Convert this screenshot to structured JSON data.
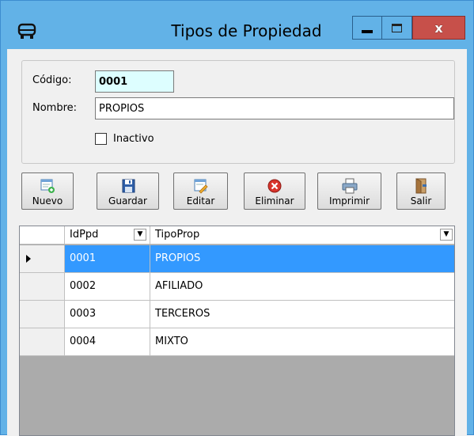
{
  "window": {
    "title": "Tipos de Propiedad",
    "close_label": "x"
  },
  "form": {
    "codigo_label": "Código:",
    "codigo_value": "0001",
    "nombre_label": "Nombre:",
    "nombre_value": "PROPIOS",
    "inactivo_label": "Inactivo",
    "inactivo_checked": false
  },
  "toolbar": {
    "nuevo": "Nuevo",
    "guardar": "Guardar",
    "editar": "Editar",
    "eliminar": "Eliminar",
    "imprimir": "Imprimir",
    "salir": "Salir"
  },
  "grid": {
    "columns": [
      "IdPpd",
      "TipoProp"
    ],
    "rows": [
      {
        "id": "0001",
        "tipo": "PROPIOS",
        "selected": true
      },
      {
        "id": "0002",
        "tipo": "AFILIADO",
        "selected": false
      },
      {
        "id": "0003",
        "tipo": "TERCEROS",
        "selected": false
      },
      {
        "id": "0004",
        "tipo": "MIXTO",
        "selected": false
      }
    ]
  },
  "colors": {
    "title_bg": "#62b2e7",
    "close_bg": "#c7504a",
    "codigo_bg": "#ddfeff",
    "selection": "#3399ff"
  }
}
